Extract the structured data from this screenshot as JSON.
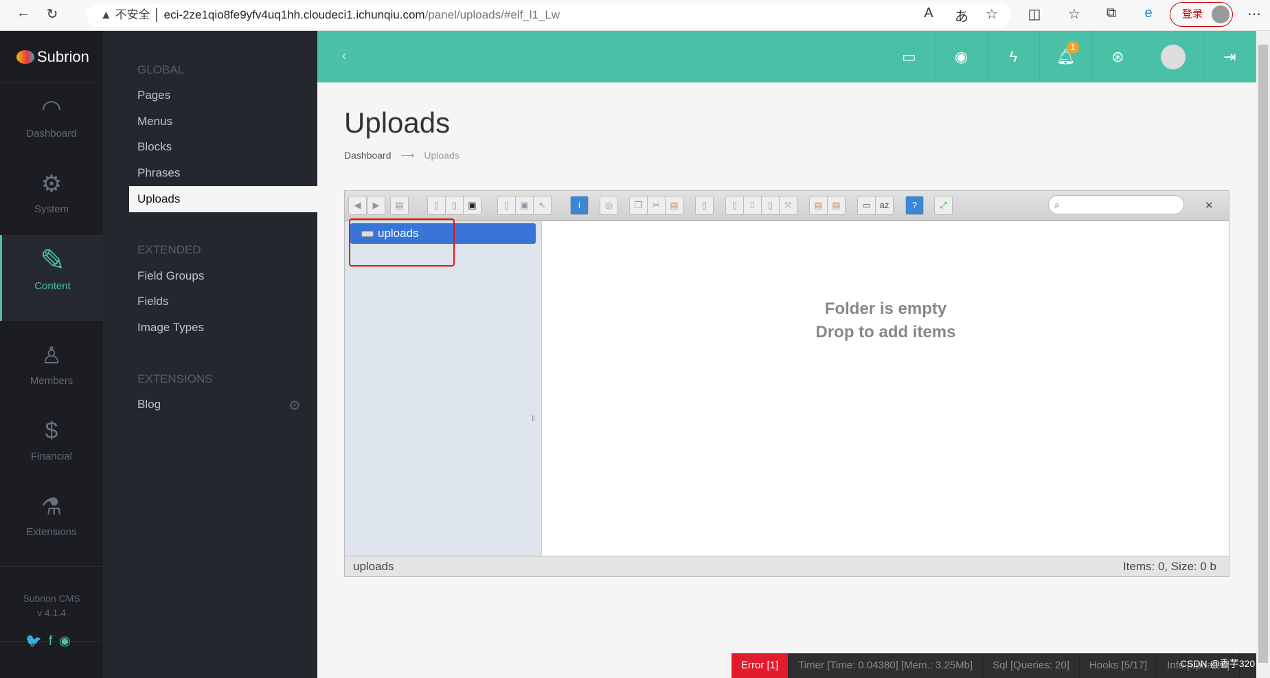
{
  "browser": {
    "security": "不安全",
    "url_host": "eci-2ze1qio8fe9yfv4uq1hh.cloudeci1.ichunqiu.com",
    "url_path": "/panel/uploads/#elf_l1_Lw",
    "login": "登录"
  },
  "app": {
    "logo": "Subrion",
    "version_name": "Subrion CMS",
    "version": "v 4.1.4",
    "accent": "#4ac1a6"
  },
  "nav": [
    {
      "label": "Dashboard",
      "icon": "dashboard-icon"
    },
    {
      "label": "System",
      "icon": "gear-icon"
    },
    {
      "label": "Content",
      "icon": "pencil-icon",
      "active": true
    },
    {
      "label": "Members",
      "icon": "user-icon"
    },
    {
      "label": "Financial",
      "icon": "money-icon"
    },
    {
      "label": "Extensions",
      "icon": "flask-icon"
    }
  ],
  "submenu": {
    "global": "GLOBAL",
    "global_items": [
      "Pages",
      "Menus",
      "Blocks",
      "Phrases",
      "Uploads"
    ],
    "extended": "EXTENDED",
    "extended_items": [
      "Field Groups",
      "Fields",
      "Image Types"
    ],
    "extensions": "EXTENSIONS",
    "extensions_items": [
      "Blog"
    ]
  },
  "header": {
    "notifications": "1"
  },
  "page": {
    "title": "Uploads",
    "breadcrumb": [
      "Dashboard",
      "Uploads"
    ],
    "breadcrumb_sep": "⟶"
  },
  "elfinder": {
    "tree_root": "uploads",
    "empty_line1": "Folder is empty",
    "empty_line2": "Drop to add items",
    "status_path": "uploads",
    "status_info": "Items: 0, Size: 0 b",
    "search_placeholder": ""
  },
  "debug": [
    "Error [1]",
    "Timer [Time: 0.04380] [Mem.: 3.25Mb]",
    "Sql [Queries: 20]",
    "Hooks [5/17]",
    "Info [updates]"
  ],
  "watermark": "CSDN @香芋320"
}
